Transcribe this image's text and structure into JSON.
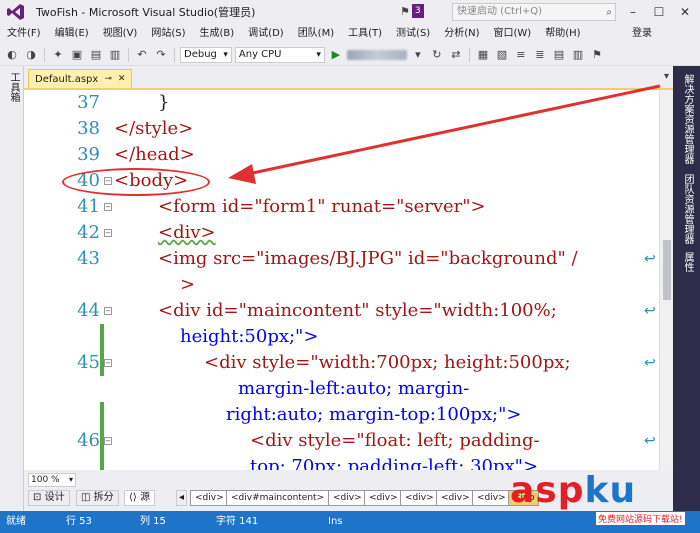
{
  "window": {
    "title": "TwoFish - Microsoft Visual Studio(管理员)",
    "notification_count": "3",
    "quick_launch_placeholder": "快速启动 (Ctrl+Q)"
  },
  "menu": [
    "文件(F)",
    "编辑(E)",
    "视图(V)",
    "网站(S)",
    "生成(B)",
    "调试(D)",
    "团队(M)",
    "工具(T)",
    "测试(S)",
    "分析(N)",
    "窗口(W)",
    "帮助(H)"
  ],
  "login_label": "登录",
  "toolbar": {
    "config": "Debug",
    "platform": "Any CPU"
  },
  "toolbox_label": "工具箱",
  "right_panels": [
    "解决方案资源管理器",
    "团队资源管理器",
    "属性"
  ],
  "tab": {
    "name": "Default.aspx"
  },
  "code_lines": [
    {
      "num": "37",
      "text": "}"
    },
    {
      "num": "38",
      "text": "</style>"
    },
    {
      "num": "39",
      "text": "</head>"
    },
    {
      "num": "40",
      "text": "<body>"
    },
    {
      "num": "41",
      "text": "<form id=\"form1\" runat=\"server\">"
    },
    {
      "num": "42",
      "text": "<div>"
    },
    {
      "num": "43",
      "text": "<img src=\"images/BJ.JPG\" id=\"background\" /"
    },
    {
      "num": "",
      "text": ">"
    },
    {
      "num": "44",
      "text": "<div id=\"maincontent\" style=\"width:100%;"
    },
    {
      "num": "",
      "text": "height:50px;\">"
    },
    {
      "num": "45",
      "text": "<div style=\"width:700px; height:500px;"
    },
    {
      "num": "",
      "text": "margin-left:auto; margin-"
    },
    {
      "num": "",
      "text": "right:auto; margin-top:100px;\">"
    },
    {
      "num": "46",
      "text": "<div style=\"float: left; padding-"
    },
    {
      "num": "",
      "text": "top: 70px; padding-left: 30px\">"
    }
  ],
  "bottom": {
    "zoom": "100 %",
    "views": [
      "设计",
      "拆分",
      "源"
    ],
    "breadcrumbs": [
      "<div>",
      "<div#maincontent>",
      "<div>",
      "<div>",
      "<div>",
      "<div>",
      "<div>",
      "<inp"
    ]
  },
  "status": {
    "ready": "就绪",
    "row": "行 53",
    "col": "列 15",
    "chars": "字符 141",
    "mode": "Ins"
  },
  "watermark": {
    "main": "asp",
    "ku": "ku",
    "sub": "免费网站源码下载站!"
  }
}
